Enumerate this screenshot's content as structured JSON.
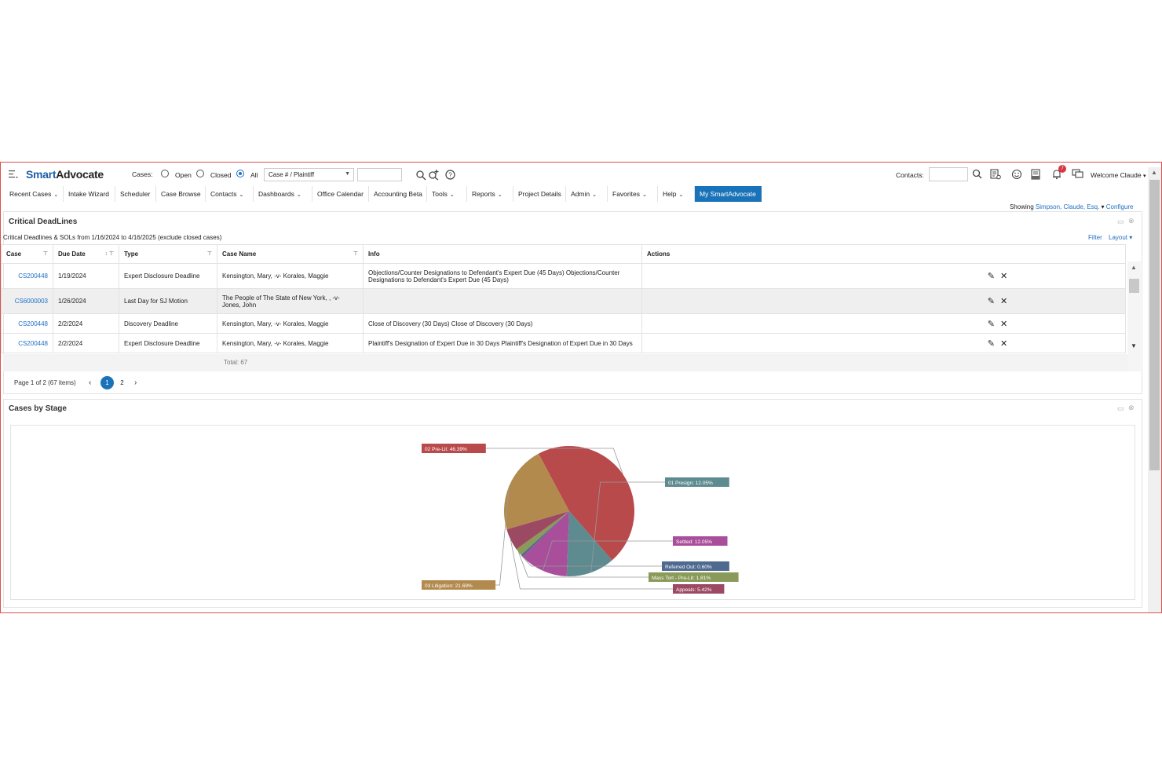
{
  "app": {
    "logo_part1": "Smart",
    "logo_part2": "Advocate"
  },
  "header": {
    "cases_label": "Cases:",
    "radio_open": "Open",
    "radio_closed": "Closed",
    "radio_all": "All",
    "search_select": "Case # / Plaintiff",
    "contacts_label": "Contacts:",
    "notifications_count": "7",
    "welcome": "Welcome Claude"
  },
  "nav": {
    "items": [
      "Recent Cases",
      "Intake Wizard",
      "Scheduler",
      "Case Browse",
      "Contacts",
      "Dashboards",
      "Office Calendar",
      "Accounting Beta",
      "Tools",
      "Reports",
      "Project Details",
      "Admin",
      "Favorites",
      "Help",
      "My SmartAdvocate"
    ]
  },
  "showing": {
    "label": "Showing",
    "user": "Simpson, Claude, Esq.",
    "configure": "Configure"
  },
  "deadlines": {
    "title": "Critical DeadLines",
    "subtitle": "Critical Deadlines & SOLs from 1/16/2024 to 4/16/2025 (exclude closed cases)",
    "filter": "Filter",
    "layout": "Layout",
    "columns": [
      "Case",
      "Due Date",
      "Type",
      "Case Name",
      "Info",
      "Actions"
    ],
    "rows": [
      {
        "case": "CS200448",
        "due": "1/19/2024",
        "type": "Expert Disclosure Deadline",
        "name": "Kensington, Mary, -v- Korales, Maggie",
        "info": "Objections/Counter Designations to Defendant's Expert Due (45 Days) Objections/Counter Designations to Defendant's Expert Due (45 Days)"
      },
      {
        "case": "CS6000003",
        "due": "1/26/2024",
        "type": "Last Day for SJ Motion",
        "name": "The People of The State of New York, , -v- Jones, John",
        "info": ""
      },
      {
        "case": "CS200448",
        "due": "2/2/2024",
        "type": "Discovery Deadline",
        "name": "Kensington, Mary, -v- Korales, Maggie",
        "info": "Close of Discovery (30 Days) Close of Discovery (30 Days)"
      },
      {
        "case": "CS200448",
        "due": "2/2/2024",
        "type": "Expert Disclosure Deadline",
        "name": "Kensington, Mary, -v- Korales, Maggie",
        "info": "Plaintiff's Designation of Expert Due in 30 Days Plaintiff's Designation of Expert Due in 30 Days"
      }
    ],
    "total": "Total: 67",
    "pager_text": "Page 1 of 2 (67 items)",
    "pages": [
      "1",
      "2"
    ]
  },
  "stage": {
    "title": "Cases by Stage"
  },
  "chart_data": {
    "type": "pie",
    "title": "Cases by Stage",
    "slices": [
      {
        "label": "02 Pre-Lit: 46.39%",
        "name": "02 Pre-Lit",
        "value": 46.39,
        "color": "#b94a4c"
      },
      {
        "label": "01 Presign: 12.05%",
        "name": "01 Presign",
        "value": 12.05,
        "color": "#5d8b8f"
      },
      {
        "label": "Settled: 12.05%",
        "name": "Settled",
        "value": 12.05,
        "color": "#a84e9a"
      },
      {
        "label": "Referred Out: 0.60%",
        "name": "Referred Out",
        "value": 0.6,
        "color": "#4f6a8f"
      },
      {
        "label": "Mass Tort - Pre-Lit: 1.81%",
        "name": "Mass Tort - Pre-Lit",
        "value": 1.81,
        "color": "#8a9a58"
      },
      {
        "label": "Appeals: 5.42%",
        "name": "Appeals",
        "value": 5.42,
        "color": "#9c4a63"
      },
      {
        "label": "03 Litigation: 21.69%",
        "name": "03 Litigation",
        "value": 21.69,
        "color": "#b38a4e"
      }
    ]
  }
}
